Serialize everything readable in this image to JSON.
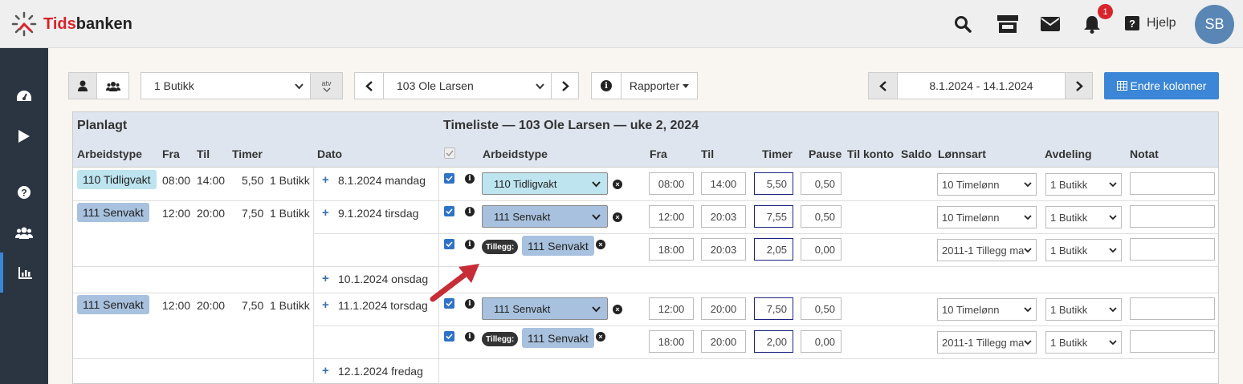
{
  "header": {
    "logo_text_red": "Tids",
    "logo_text_dark": "banken",
    "notification_count": "1",
    "help_label": "Hjelp",
    "avatar_initials": "SB"
  },
  "sidebar": {
    "items": [
      "dashboard-icon",
      "play-icon",
      "question-icon",
      "users-icon",
      "chart-icon"
    ],
    "active_index": 4
  },
  "toolbar": {
    "store_select": "1 Butikk",
    "sort_label": "atv",
    "employee_select": "103 Ole Larsen",
    "reports_label": "Rapporter",
    "date_range": "8.1.2024 - 14.1.2024",
    "edit_columns_label": "Endre kolonner"
  },
  "planned": {
    "title": "Planlagt",
    "columns": [
      "Arbeidstype",
      "Fra",
      "Til",
      "Timer",
      "Dato"
    ],
    "rows": [
      {
        "type": "110 Tidligvakt",
        "from": "08:00",
        "to": "14:00",
        "hours": "5,50",
        "store": "1 Butikk",
        "date": "8.1.2024 mandag"
      },
      {
        "type": "111 Senvakt",
        "from": "12:00",
        "to": "20:00",
        "hours": "7,50",
        "store": "1 Butikk",
        "date": "9.1.2024 tirsdag"
      },
      {
        "date": "10.1.2024 onsdag"
      },
      {
        "type": "111 Senvakt",
        "from": "12:00",
        "to": "20:00",
        "hours": "7,50",
        "store": "1 Butikk",
        "date": "11.1.2024 torsdag"
      },
      {
        "date": "12.1.2024 fredag"
      }
    ]
  },
  "timesheet": {
    "title": "Timeliste — 103 Ole Larsen — uke 2, 2024",
    "columns": [
      "Arbeidstype",
      "Fra",
      "Til",
      "Timer",
      "Pause",
      "Til konto",
      "Saldo",
      "Lønnsart",
      "Avdeling",
      "Notat"
    ],
    "tillegg_label": "Tillegg:",
    "rows": [
      {
        "type": "110 Tidligvakt",
        "from": "08:00",
        "to": "14:00",
        "hours": "5,50",
        "pause": "0,50",
        "wage": "10 Timelønn",
        "dept": "1 Butikk",
        "note": ""
      },
      {
        "type": "111 Senvakt",
        "from": "12:00",
        "to": "20:03",
        "hours": "7,55",
        "pause": "0,50",
        "wage": "10 Timelønn",
        "dept": "1 Butikk",
        "note": ""
      },
      {
        "type": "111 Senvakt",
        "from": "18:00",
        "to": "20:03",
        "hours": "2,05",
        "pause": "0,00",
        "wage": "2011-1 Tillegg ma",
        "dept": "1 Butikk",
        "note": ""
      },
      {
        "type": "111 Senvakt",
        "from": "12:00",
        "to": "20:00",
        "hours": "7,50",
        "pause": "0,50",
        "wage": "10 Timelønn",
        "dept": "1 Butikk",
        "note": ""
      },
      {
        "type": "111 Senvakt",
        "from": "18:00",
        "to": "20:00",
        "hours": "2,00",
        "pause": "0,00",
        "wage": "2011-1 Tillegg ma",
        "dept": "1 Butikk",
        "note": ""
      }
    ]
  },
  "colors": {
    "accent": "#3b86d6",
    "brand_red": "#d9242a",
    "sidebar": "#2b3541",
    "arrow": "#c62d36"
  }
}
